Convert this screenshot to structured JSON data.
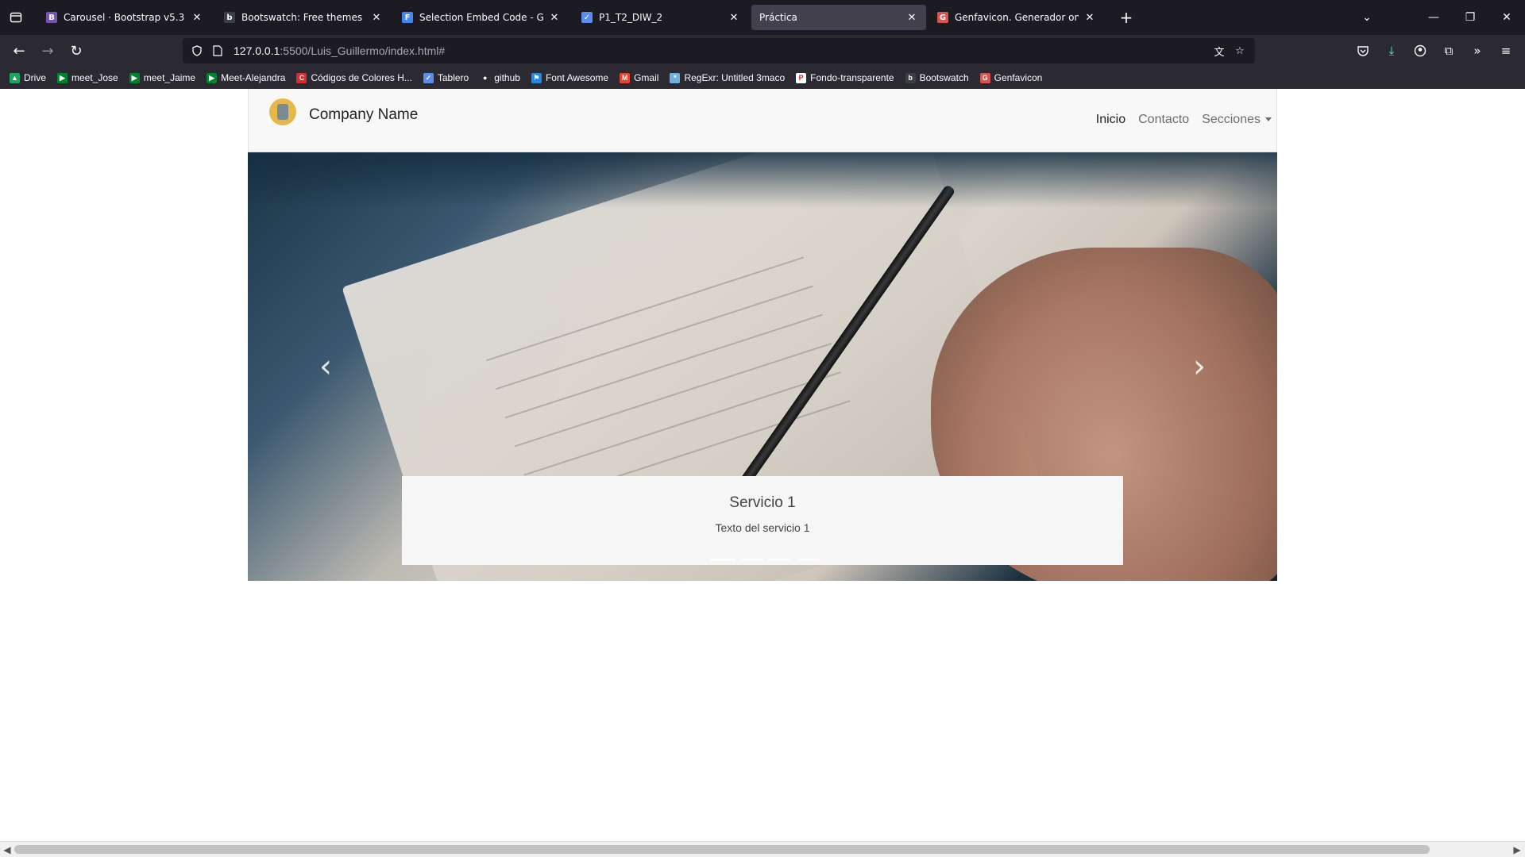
{
  "browser": {
    "tabs": [
      {
        "title": "Carousel · Bootstrap v5.3",
        "favicon": "bootstrap-icon",
        "color": "#7952b3",
        "glyph": "B",
        "active": false
      },
      {
        "title": "Bootswatch: Free themes for Bo",
        "favicon": "bootswatch-icon",
        "color": "#3a3f44",
        "glyph": "b",
        "active": false
      },
      {
        "title": "Selection Embed Code - Googl",
        "favicon": "google-fonts-icon",
        "color": "#4285f4",
        "glyph": "F",
        "active": false
      },
      {
        "title": "P1_T2_DIW_2",
        "favicon": "tasks-icon",
        "color": "#5b8def",
        "glyph": "✓",
        "active": false
      },
      {
        "title": "Práctica",
        "favicon": "",
        "color": "",
        "glyph": "",
        "active": true
      },
      {
        "title": "Genfavicon. Generador online g",
        "favicon": "genfavicon-icon",
        "color": "#d9534f",
        "glyph": "G",
        "active": false
      }
    ],
    "url": {
      "host": "127.0.0.1",
      "path": ":5500/Luis_Guillermo/index.html#"
    },
    "bookmarks": [
      {
        "label": "Drive",
        "icon": "drive-icon",
        "color": "#1fa463",
        "glyph": "▲"
      },
      {
        "label": "meet_Jose",
        "icon": "meet-icon",
        "color": "#00832d",
        "glyph": "▶"
      },
      {
        "label": "meet_Jaime",
        "icon": "meet-icon",
        "color": "#00832d",
        "glyph": "▶"
      },
      {
        "label": "Meet-Alejandra",
        "icon": "meet-icon",
        "color": "#00832d",
        "glyph": "▶"
      },
      {
        "label": "Códigos de Colores H...",
        "icon": "color-codes-icon",
        "color": "#d32f2f",
        "glyph": "C"
      },
      {
        "label": "Tablero",
        "icon": "board-icon",
        "color": "#5b8def",
        "glyph": "✓"
      },
      {
        "label": "github",
        "icon": "github-icon",
        "color": "#2b2a33",
        "glyph": "●"
      },
      {
        "label": "Font Awesome",
        "icon": "font-awesome-icon",
        "color": "#228ae6",
        "glyph": "⚑"
      },
      {
        "label": "Gmail",
        "icon": "gmail-icon",
        "color": "#ea4335",
        "glyph": "M"
      },
      {
        "label": "RegExr: Untitled 3maco",
        "icon": "regexr-icon",
        "color": "#70b0e0",
        "glyph": "*"
      },
      {
        "label": "Fondo-transparente",
        "icon": "pdf-icon",
        "color": "#ffffff",
        "glyph": "P"
      },
      {
        "label": "Bootswatch",
        "icon": "bootswatch-icon",
        "color": "#3a3f44",
        "glyph": "b"
      },
      {
        "label": "Genfavicon",
        "icon": "genfavicon-icon",
        "color": "#d9534f",
        "glyph": "G"
      }
    ]
  },
  "site": {
    "brand": "Company Name",
    "nav": [
      {
        "label": "Inicio",
        "active": true
      },
      {
        "label": "Contacto",
        "active": false
      },
      {
        "label": "Secciones",
        "active": false,
        "dropdown": true
      }
    ],
    "carousel": {
      "caption_title": "Servicio 1",
      "caption_text": "Texto del servicio 1",
      "slide_count": 4,
      "active_slide": 1
    }
  }
}
